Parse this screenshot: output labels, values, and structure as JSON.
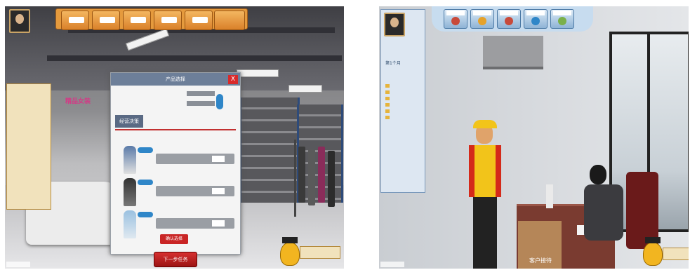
{
  "left_screenshot": {
    "store_sign": "精品女装",
    "top_bar": {
      "buttons": [
        "",
        "",
        "",
        "",
        ""
      ]
    },
    "sidebar": {
      "items": [
        "",
        "",
        "",
        "",
        "",
        "",
        ""
      ]
    },
    "dialog": {
      "title": "产品选择",
      "close_label": "X",
      "section_label": "经营决策",
      "rows": [
        "",
        ""
      ],
      "products": [
        {
          "name": "",
          "price": ""
        },
        {
          "name": "",
          "price": ""
        },
        {
          "name": "",
          "price": ""
        }
      ],
      "confirm_label": "确认选择"
    },
    "next_step_label": "下一步任务",
    "help_label": ""
  },
  "right_screenshot": {
    "top_bar": {
      "buttons": [
        "",
        "",
        "",
        "",
        ""
      ]
    },
    "panel": {
      "header": "第1个月",
      "items": [
        "",
        "",
        "",
        "",
        "",
        ""
      ]
    },
    "scene_label": "客户接待",
    "help_label": ""
  },
  "colors": {
    "accent_orange": "#e59a3d",
    "accent_red": "#c92525",
    "accent_blue": "#8fb4d6"
  }
}
